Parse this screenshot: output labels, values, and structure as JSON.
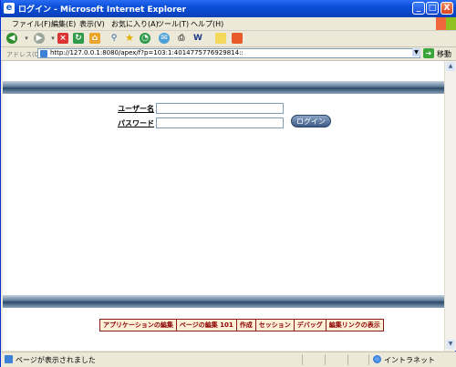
{
  "window": {
    "title": "ログイン - Microsoft Internet Explorer",
    "minimize": "_",
    "maximize": "□",
    "close": "X"
  },
  "menubar": {
    "items": [
      "ファイル(F)",
      "編集(E)",
      "表示(V)",
      "お気に入り(A)",
      "ツール(T)",
      "ヘルプ(H)"
    ]
  },
  "addressbar": {
    "label": "アドレス(D)",
    "url": "http://127.0.0.1:8080/apex/f?p=103:1:4014775776929814::",
    "go_label": "移動"
  },
  "login": {
    "username_label": "ユーザー名",
    "password_label": "パスワード",
    "username_value": "",
    "password_value": "",
    "button_label": "ログイン"
  },
  "devbar": {
    "items": [
      "アプリケーションの編集",
      "ページの編集 101",
      "作成",
      "セッション",
      "デバッグ",
      "編集リンクの表示"
    ]
  },
  "statusbar": {
    "text": "ページが表示されました",
    "zone": "イントラネット"
  },
  "colors": {
    "titlebar": "#0b4fd8",
    "band": "#2b4a6a",
    "devbar_text": "#8b0000"
  }
}
